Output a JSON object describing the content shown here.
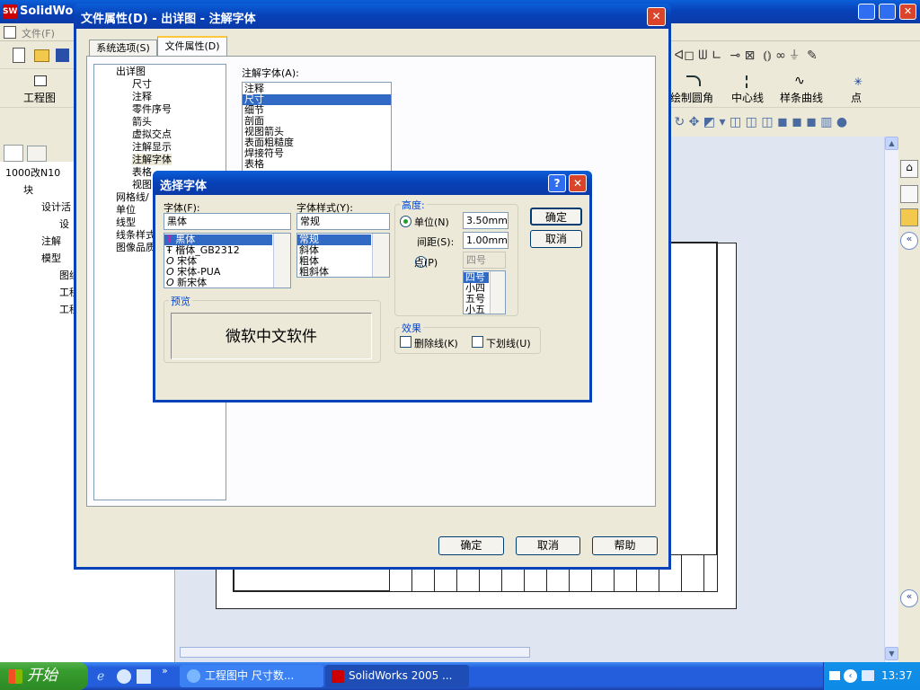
{
  "app": {
    "title": "SolidWorks",
    "menu_file": "文件(F)",
    "tabs_tree": [
      "1000改N10",
      "块",
      "设计活",
      "设",
      "注解",
      "模型",
      "图纸",
      "工程",
      "工程"
    ],
    "toolbar_right": {
      "sketch_fillet": "绘制圆角",
      "centerline": "中心线",
      "spline": "样条曲线",
      "point": "点"
    },
    "quick_top_icons": [
      "drawing-icon",
      "sheet-icon"
    ],
    "drawing_label": "工程图"
  },
  "doc_dialog": {
    "title": "文件属性(D) - 出详图 - 注解字体",
    "tab_system": "系统选项(S)",
    "tab_doc": "文件属性(D)",
    "tree": [
      "出详图",
      "尺寸",
      "注释",
      "零件序号",
      "箭头",
      "虚拟交点",
      "注解显示",
      "注解字体",
      "表格",
      "视图",
      "网格线/",
      "单位",
      "线型",
      "线条样式",
      "图像品质"
    ],
    "font_label": "注解字体(A):",
    "font_list": [
      "注释",
      "尺寸",
      "细节",
      "剖面",
      "视图箭头",
      "表面粗糙度",
      "焊接符号",
      "表格"
    ],
    "ok": "确定",
    "cancel": "取消",
    "help": "帮助"
  },
  "font_dialog": {
    "title": "选择字体",
    "help_icon": "?",
    "font_label": "字体(F):",
    "font_value": "黑体",
    "fonts": [
      "黑体",
      "楷体_GB2312",
      "宋体",
      "宋体-PUA",
      "新宋体"
    ],
    "style_label": "字体样式(Y):",
    "style_value": "常规",
    "styles": [
      "常规",
      "斜体",
      "粗体",
      "粗斜体"
    ],
    "height_group": "高度:",
    "unit_label": "单位(N)",
    "unit_value": "3.50mm",
    "spacing_label": "间距(S):",
    "spacing_value": "1.00mm",
    "point_label": "点(P)",
    "point_value": "四号",
    "sizes": [
      "四号",
      "小四",
      "五号",
      "小五"
    ],
    "preview_group": "预览",
    "preview_text": "微软中文软件",
    "effects_group": "效果",
    "strike_label": "删除线(K)",
    "underline_label": "下划线(U)",
    "ok": "确定",
    "cancel": "取消"
  },
  "taskbar": {
    "start": "开始",
    "task1": "工程图中 尺寸数...",
    "task2": "SolidWorks 2005 ...",
    "clock": "13:37"
  }
}
